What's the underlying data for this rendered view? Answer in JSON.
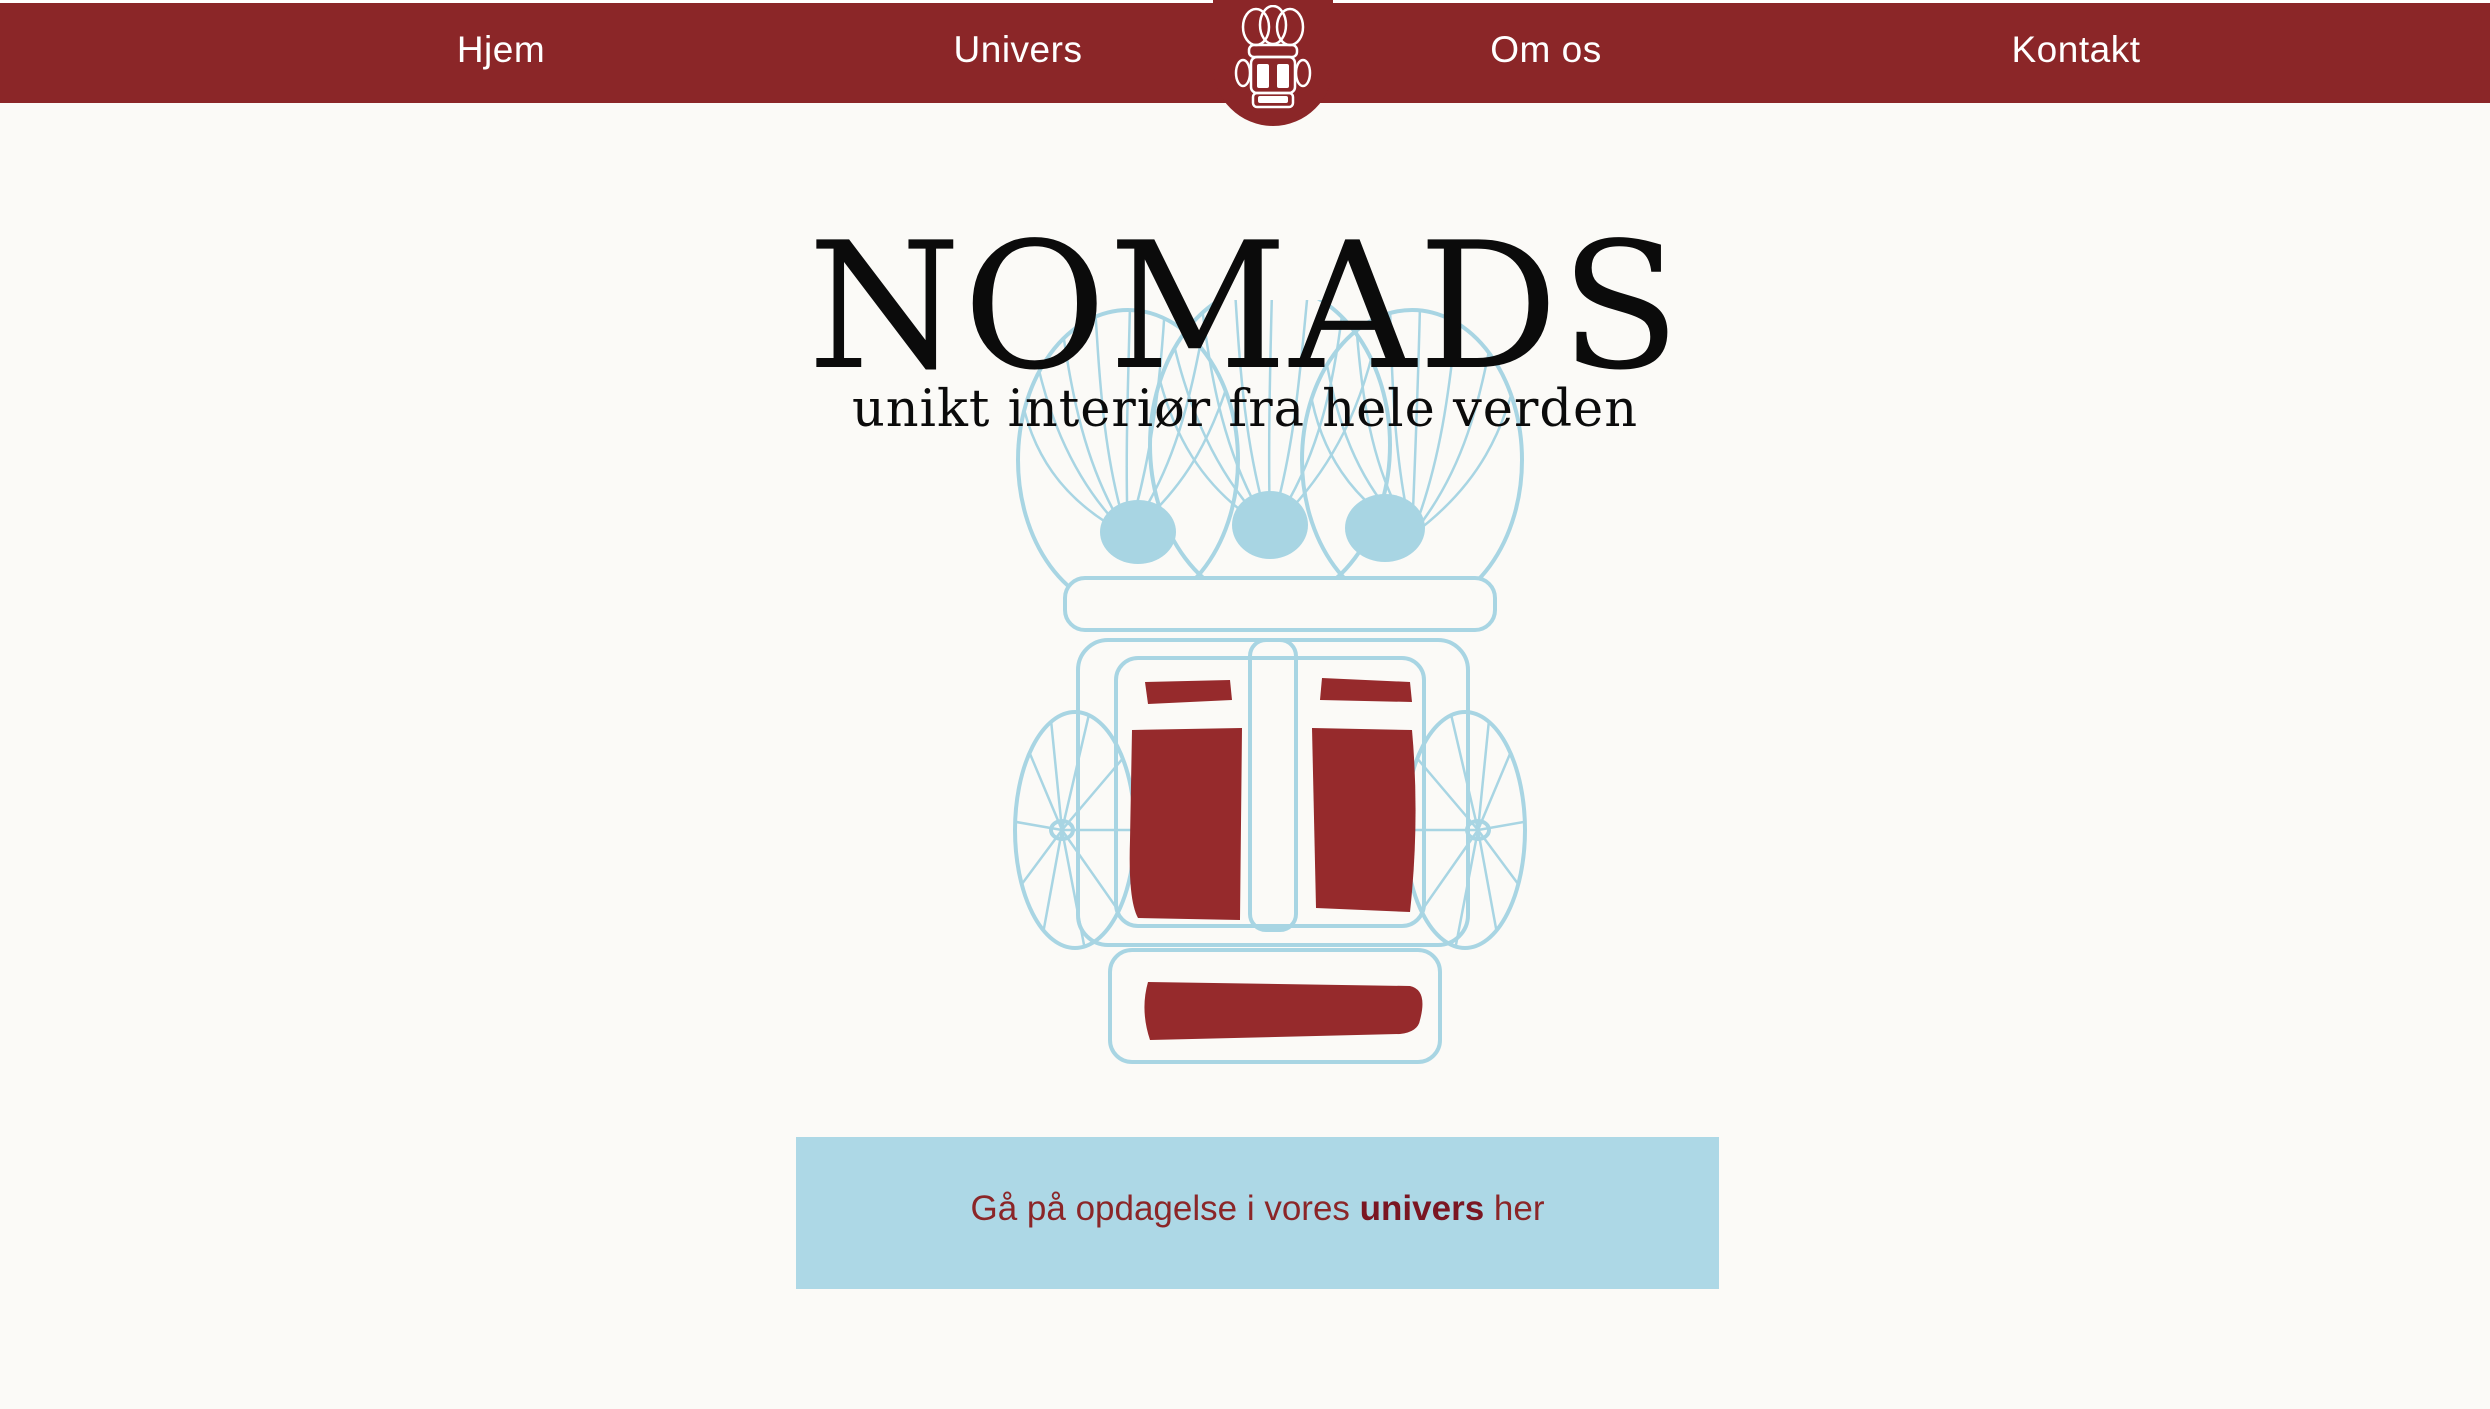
{
  "nav": {
    "items": [
      {
        "label": "Hjem"
      },
      {
        "label": "Univers"
      },
      {
        "label": "Om os"
      },
      {
        "label": "Kontakt"
      }
    ],
    "logo_icon": "tribal-mask-icon"
  },
  "hero": {
    "title": "NOMADS",
    "subtitle": "unikt interiør fra hele verden",
    "illustration_icon": "tribal-mask-icon"
  },
  "cta": {
    "prefix": "Gå på opdagelse i vores",
    "link_label": "univers",
    "suffix": "her"
  },
  "colors": {
    "brand_red": "#8b2628",
    "sky_blue": "#add8e6",
    "background": "#fbfaf7",
    "text_dark": "#0b0b0b"
  }
}
